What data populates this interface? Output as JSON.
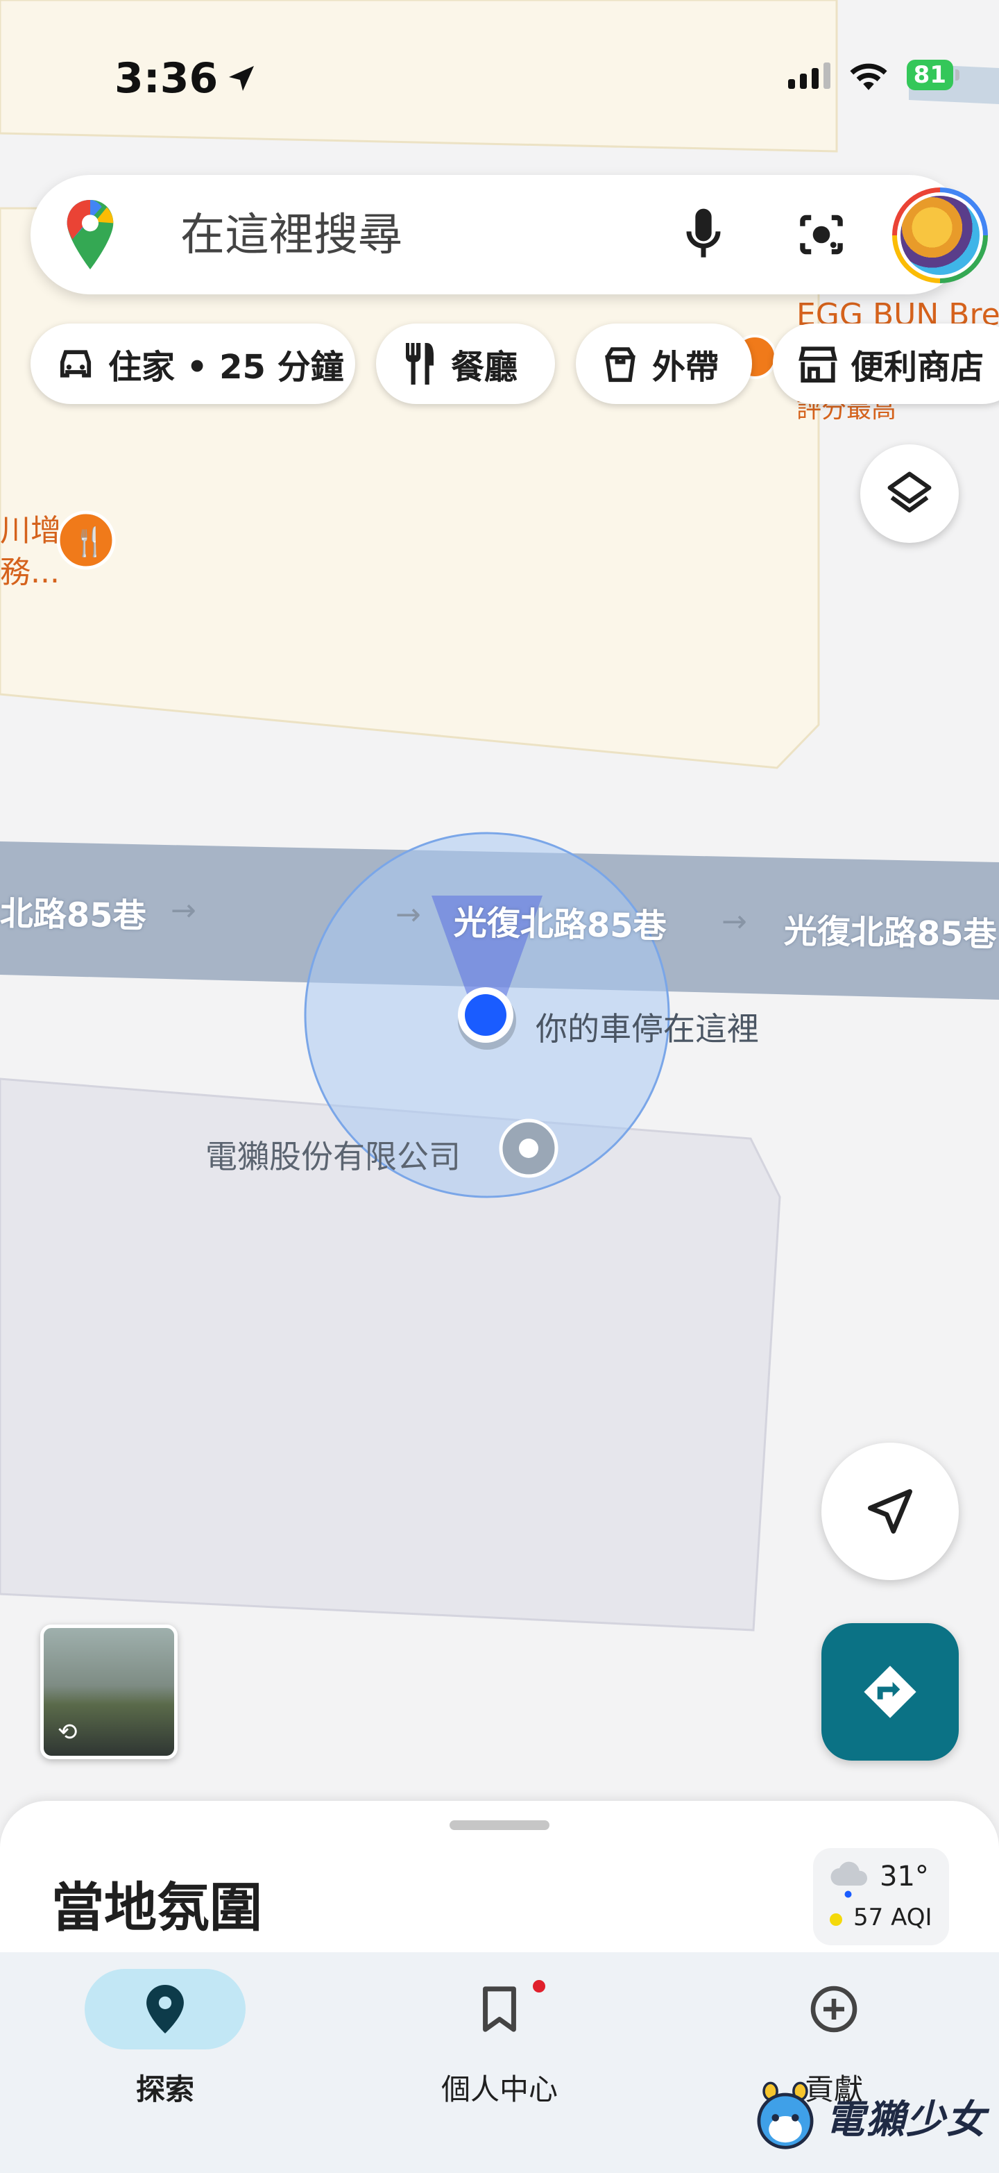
{
  "status_bar": {
    "time": "3:36",
    "battery": "81"
  },
  "search": {
    "placeholder": "在這裡搜尋"
  },
  "chips": [
    {
      "label": "住家 • 25 分鐘",
      "icon": "car-icon"
    },
    {
      "label": "餐廳",
      "icon": "restaurant-icon"
    },
    {
      "label": "外帶",
      "icon": "takeout-icon"
    },
    {
      "label": "便利商店",
      "icon": "store-icon"
    }
  ],
  "map": {
    "street_name_left": "北路85巷",
    "street_name_center": "光復北路85巷",
    "street_name_right": "光復北路85巷",
    "parked_car_label": "你的車停在這裡",
    "company_label": "電獺股份有限公司",
    "poi_top_right": "EGG BUN Bre",
    "poi_top_right_sub": "評分最高",
    "poi_left_line1": "川增",
    "poi_left_line2": "務..."
  },
  "sheet": {
    "title": "當地氛圍"
  },
  "weather": {
    "temperature": "31°",
    "aqi": "57 AQI"
  },
  "bottom_nav": [
    {
      "label": "探索",
      "icon": "location-pin-icon",
      "active": true
    },
    {
      "label": "個人中心",
      "icon": "bookmark-icon",
      "active": false
    },
    {
      "label": "貢獻",
      "icon": "add-circle-icon",
      "active": false
    }
  ],
  "watermark": {
    "text": "電獺少女"
  },
  "colors": {
    "accent": "#0b7285",
    "location_blue": "#1a5cff",
    "chip_bg": "#ffffff",
    "nav_active": "#c2e7f5"
  }
}
